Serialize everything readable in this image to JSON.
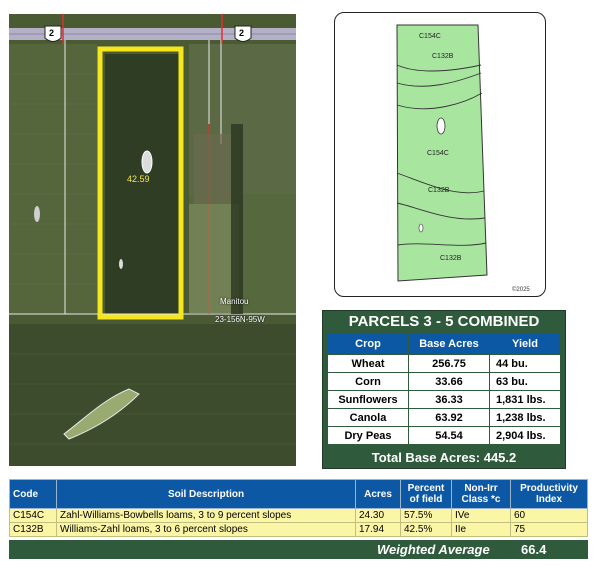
{
  "aerial_map": {
    "highway_shield": "2",
    "parcel_acres": "42.59",
    "road_name": "Manitou",
    "section_label": "23-156N-95W"
  },
  "soil_map": {
    "labels": [
      "C154C",
      "C132B",
      "C154C",
      "C132B",
      "C132B"
    ],
    "copyright": "©2025",
    "fill_color": "#a8e6a0"
  },
  "parcels_table": {
    "title": "PARCELS 3 - 5 COMBINED",
    "headers": [
      "Crop",
      "Base Acres",
      "Yield"
    ],
    "rows": [
      [
        "Wheat",
        "256.75",
        "44 bu."
      ],
      [
        "Corn",
        "33.66",
        "63 bu."
      ],
      [
        "Sunflowers",
        "36.33",
        "1,831 lbs."
      ],
      [
        "Canola",
        "63.92",
        "1,238 lbs."
      ],
      [
        "Dry Peas",
        "54.54",
        "2,904 lbs."
      ]
    ],
    "total": "Total Base Acres:  445.2",
    "colors": {
      "frame": "#2f5a3c",
      "header": "#0d58a5"
    }
  },
  "soil_table": {
    "headers": [
      "Code",
      "Soil Description",
      "Acres",
      "Percent of field",
      "Non-Irr Class *c",
      "Productivity Index"
    ],
    "rows": [
      [
        "C154C",
        "Zahl-Williams-Bowbells loams, 3 to 9 percent slopes",
        "24.30",
        "57.5%",
        "IVe",
        "60"
      ],
      [
        "C132B",
        "Williams-Zahl loams, 3 to 6 percent slopes",
        "17.94",
        "42.5%",
        "IIe",
        "75"
      ]
    ],
    "weighted_label": "Weighted Average",
    "weighted_value": "66.4",
    "colors": {
      "row_fill": "#fbf6a6",
      "header": "#0d58a5"
    }
  }
}
